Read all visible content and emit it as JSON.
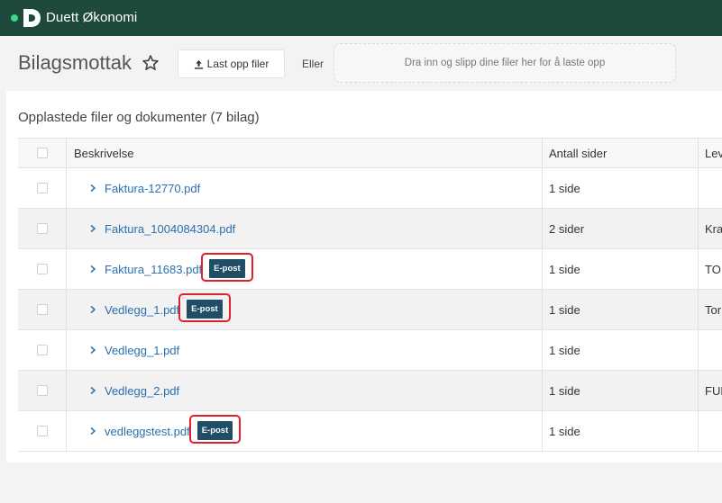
{
  "app": {
    "brand": "Duett Økonomi"
  },
  "page": {
    "title": "Bilagsmottak",
    "upload_label": "Last opp filer",
    "or_label": "Eller",
    "dropzone_text": "Dra inn og slipp dine filer her for å laste opp"
  },
  "section": {
    "title": "Opplastede filer og dokumenter (7 bilag)"
  },
  "table": {
    "headers": {
      "description": "Beskrivelse",
      "pages": "Antall sider",
      "supplier": "Lev"
    },
    "rows": [
      {
        "name": "Faktura-12770.pdf",
        "pages": "1 side",
        "supplier": "",
        "tag": ""
      },
      {
        "name": "Faktura_1004084304.pdf",
        "pages": "2 sider",
        "supplier": "Kra",
        "tag": ""
      },
      {
        "name": "Faktura_11683.pdf",
        "pages": "1 side",
        "supplier": "TOI",
        "tag": "E-post"
      },
      {
        "name": "Vedlegg_1.pdf",
        "pages": "1 side",
        "supplier": "Tor",
        "tag": "E-post"
      },
      {
        "name": "Vedlegg_1.pdf",
        "pages": "1 side",
        "supplier": "",
        "tag": ""
      },
      {
        "name": "Vedlegg_2.pdf",
        "pages": "1 side",
        "supplier": "FUK",
        "tag": ""
      },
      {
        "name": "vedleggstest.pdf",
        "pages": "1 side",
        "supplier": "",
        "tag": "E-post"
      }
    ]
  },
  "colors": {
    "topbar": "#1e4a3e",
    "accent": "#3ed28a",
    "link": "#2a6fb0",
    "tag": "#1f4e66",
    "highlight": "#e0202a"
  }
}
